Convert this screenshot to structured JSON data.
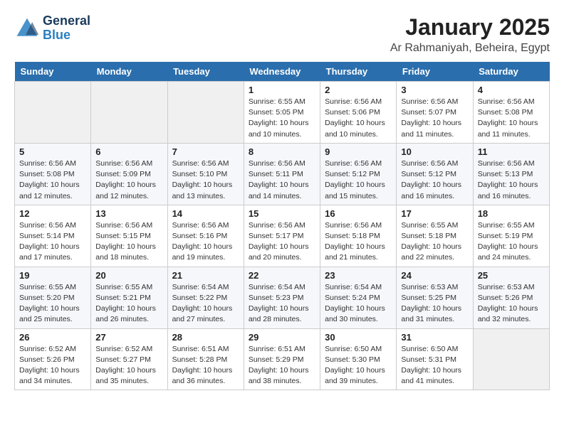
{
  "header": {
    "logo_line1": "General",
    "logo_line2": "Blue",
    "month": "January 2025",
    "location": "Ar Rahmaniyah, Beheira, Egypt"
  },
  "weekdays": [
    "Sunday",
    "Monday",
    "Tuesday",
    "Wednesday",
    "Thursday",
    "Friday",
    "Saturday"
  ],
  "weeks": [
    [
      {
        "day": "",
        "info": ""
      },
      {
        "day": "",
        "info": ""
      },
      {
        "day": "",
        "info": ""
      },
      {
        "day": "1",
        "info": "Sunrise: 6:55 AM\nSunset: 5:05 PM\nDaylight: 10 hours\nand 10 minutes."
      },
      {
        "day": "2",
        "info": "Sunrise: 6:56 AM\nSunset: 5:06 PM\nDaylight: 10 hours\nand 10 minutes."
      },
      {
        "day": "3",
        "info": "Sunrise: 6:56 AM\nSunset: 5:07 PM\nDaylight: 10 hours\nand 11 minutes."
      },
      {
        "day": "4",
        "info": "Sunrise: 6:56 AM\nSunset: 5:08 PM\nDaylight: 10 hours\nand 11 minutes."
      }
    ],
    [
      {
        "day": "5",
        "info": "Sunrise: 6:56 AM\nSunset: 5:08 PM\nDaylight: 10 hours\nand 12 minutes."
      },
      {
        "day": "6",
        "info": "Sunrise: 6:56 AM\nSunset: 5:09 PM\nDaylight: 10 hours\nand 12 minutes."
      },
      {
        "day": "7",
        "info": "Sunrise: 6:56 AM\nSunset: 5:10 PM\nDaylight: 10 hours\nand 13 minutes."
      },
      {
        "day": "8",
        "info": "Sunrise: 6:56 AM\nSunset: 5:11 PM\nDaylight: 10 hours\nand 14 minutes."
      },
      {
        "day": "9",
        "info": "Sunrise: 6:56 AM\nSunset: 5:12 PM\nDaylight: 10 hours\nand 15 minutes."
      },
      {
        "day": "10",
        "info": "Sunrise: 6:56 AM\nSunset: 5:12 PM\nDaylight: 10 hours\nand 16 minutes."
      },
      {
        "day": "11",
        "info": "Sunrise: 6:56 AM\nSunset: 5:13 PM\nDaylight: 10 hours\nand 16 minutes."
      }
    ],
    [
      {
        "day": "12",
        "info": "Sunrise: 6:56 AM\nSunset: 5:14 PM\nDaylight: 10 hours\nand 17 minutes."
      },
      {
        "day": "13",
        "info": "Sunrise: 6:56 AM\nSunset: 5:15 PM\nDaylight: 10 hours\nand 18 minutes."
      },
      {
        "day": "14",
        "info": "Sunrise: 6:56 AM\nSunset: 5:16 PM\nDaylight: 10 hours\nand 19 minutes."
      },
      {
        "day": "15",
        "info": "Sunrise: 6:56 AM\nSunset: 5:17 PM\nDaylight: 10 hours\nand 20 minutes."
      },
      {
        "day": "16",
        "info": "Sunrise: 6:56 AM\nSunset: 5:18 PM\nDaylight: 10 hours\nand 21 minutes."
      },
      {
        "day": "17",
        "info": "Sunrise: 6:55 AM\nSunset: 5:18 PM\nDaylight: 10 hours\nand 22 minutes."
      },
      {
        "day": "18",
        "info": "Sunrise: 6:55 AM\nSunset: 5:19 PM\nDaylight: 10 hours\nand 24 minutes."
      }
    ],
    [
      {
        "day": "19",
        "info": "Sunrise: 6:55 AM\nSunset: 5:20 PM\nDaylight: 10 hours\nand 25 minutes."
      },
      {
        "day": "20",
        "info": "Sunrise: 6:55 AM\nSunset: 5:21 PM\nDaylight: 10 hours\nand 26 minutes."
      },
      {
        "day": "21",
        "info": "Sunrise: 6:54 AM\nSunset: 5:22 PM\nDaylight: 10 hours\nand 27 minutes."
      },
      {
        "day": "22",
        "info": "Sunrise: 6:54 AM\nSunset: 5:23 PM\nDaylight: 10 hours\nand 28 minutes."
      },
      {
        "day": "23",
        "info": "Sunrise: 6:54 AM\nSunset: 5:24 PM\nDaylight: 10 hours\nand 30 minutes."
      },
      {
        "day": "24",
        "info": "Sunrise: 6:53 AM\nSunset: 5:25 PM\nDaylight: 10 hours\nand 31 minutes."
      },
      {
        "day": "25",
        "info": "Sunrise: 6:53 AM\nSunset: 5:26 PM\nDaylight: 10 hours\nand 32 minutes."
      }
    ],
    [
      {
        "day": "26",
        "info": "Sunrise: 6:52 AM\nSunset: 5:26 PM\nDaylight: 10 hours\nand 34 minutes."
      },
      {
        "day": "27",
        "info": "Sunrise: 6:52 AM\nSunset: 5:27 PM\nDaylight: 10 hours\nand 35 minutes."
      },
      {
        "day": "28",
        "info": "Sunrise: 6:51 AM\nSunset: 5:28 PM\nDaylight: 10 hours\nand 36 minutes."
      },
      {
        "day": "29",
        "info": "Sunrise: 6:51 AM\nSunset: 5:29 PM\nDaylight: 10 hours\nand 38 minutes."
      },
      {
        "day": "30",
        "info": "Sunrise: 6:50 AM\nSunset: 5:30 PM\nDaylight: 10 hours\nand 39 minutes."
      },
      {
        "day": "31",
        "info": "Sunrise: 6:50 AM\nSunset: 5:31 PM\nDaylight: 10 hours\nand 41 minutes."
      },
      {
        "day": "",
        "info": ""
      }
    ]
  ]
}
